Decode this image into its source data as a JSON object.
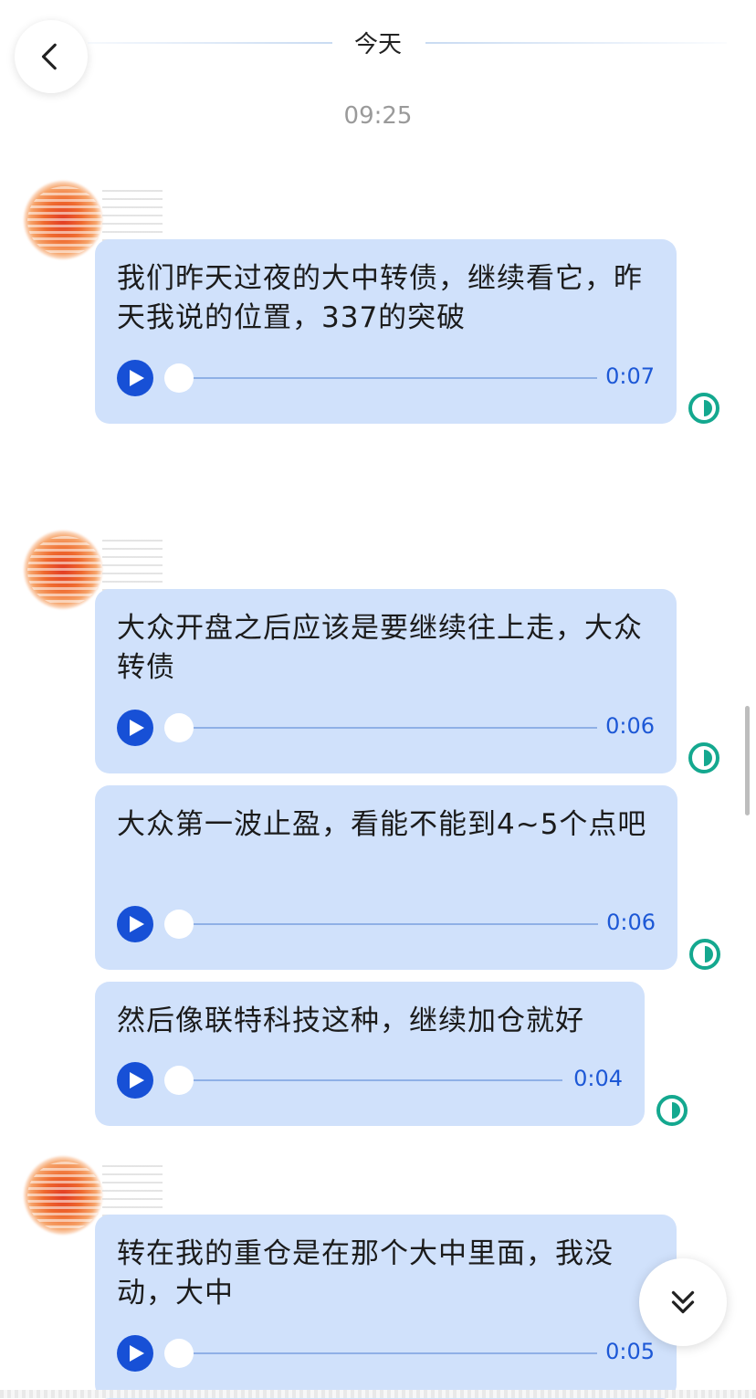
{
  "header": {
    "back_icon": "chevron-left-icon",
    "date_divider": "今天"
  },
  "time_stamp": "09:25",
  "messages": [
    {
      "text": "我们昨天过夜的大中转债，继续看它，昨天我说的位置，337的突破",
      "duration": "0:07",
      "status_icon": "read-half-circle-icon"
    },
    {
      "text": "大众开盘之后应该是要继续往上走，大众转债",
      "duration": "0:06",
      "status_icon": "read-half-circle-icon"
    },
    {
      "text": "大众第一波止盈，看能不能到4~5个点吧",
      "duration": "0:06",
      "status_icon": "read-half-circle-icon"
    },
    {
      "text": "然后像联特科技这种，继续加仓就好",
      "duration": "0:04",
      "status_icon": "read-half-circle-icon"
    },
    {
      "text": "转在我的重仓是在那个大中里面，我没动，大中",
      "duration": "0:05",
      "status_icon": "read-half-circle-icon"
    }
  ],
  "controls": {
    "scroll_down_icon": "double-chevron-down-icon",
    "play_icon": "play-icon"
  },
  "colors": {
    "bubble": "#d0e1fb",
    "play": "#1750d6",
    "duration_text": "#1d58d6",
    "read_icon": "#14a88f"
  }
}
